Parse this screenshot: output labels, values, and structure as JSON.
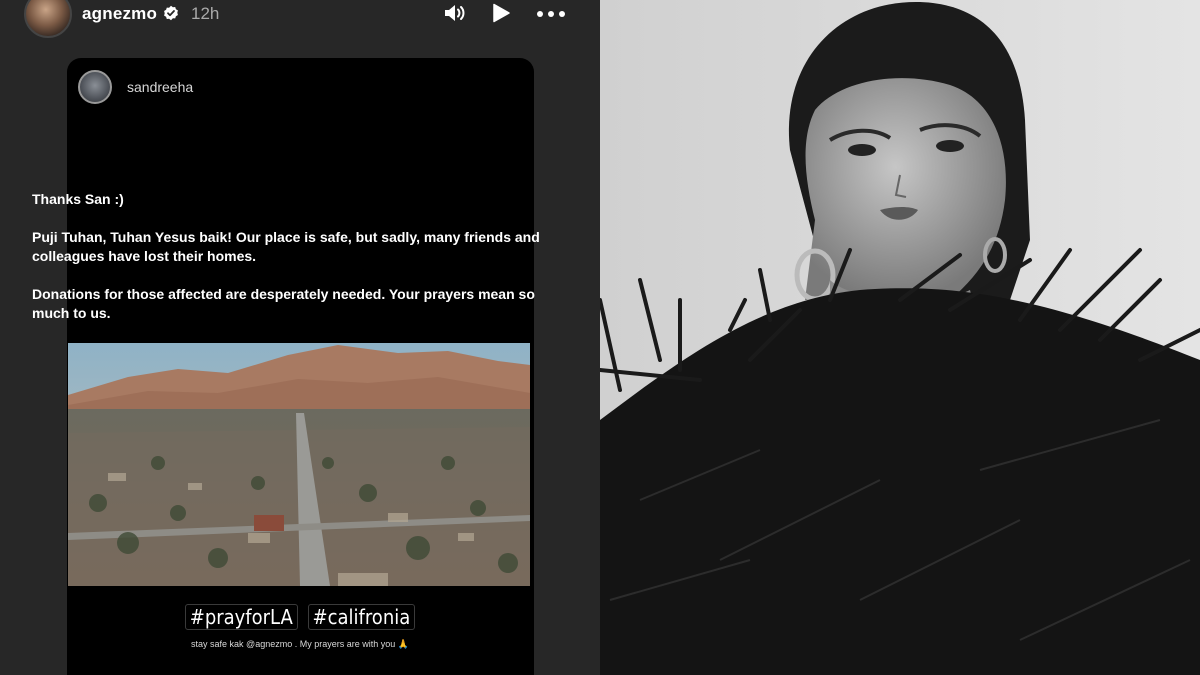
{
  "story_header": {
    "username": "agnezmo",
    "time": "12h"
  },
  "reshare": {
    "username": "sandreeha"
  },
  "post": {
    "paragraphs": [
      "Thanks San :)",
      "Puji Tuhan, Tuhan Yesus baik! Our place is safe, but sadly, many friends and colleagues have lost their homes.",
      "Donations for those affected are desperately needed. Your prayers mean so much to us."
    ],
    "hashtags": [
      "#prayforLA",
      "#califronia"
    ],
    "caption": "stay safe kak @agnezmo . My prayers are with you 🙏"
  },
  "icons": [
    "verified-badge-icon",
    "volume-icon",
    "play-icon",
    "more-options-icon"
  ],
  "colors": {
    "left_background": "#272727",
    "card_background": "#000000",
    "text": "#ffffff"
  }
}
